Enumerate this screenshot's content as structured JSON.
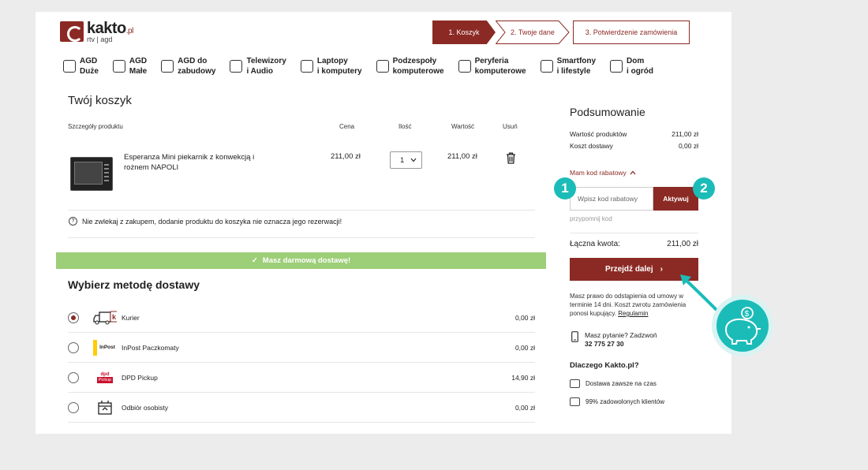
{
  "header": {
    "logo_text": "kakto",
    "logo_tld": ".pl",
    "logo_sub": "rtv | agd",
    "steps": [
      "1. Koszyk",
      "2. Twoje dane",
      "3. Potwierdzenie zamówienia"
    ]
  },
  "categories": [
    {
      "line1": "AGD",
      "line2": "Duże"
    },
    {
      "line1": "AGD",
      "line2": "Małe"
    },
    {
      "line1": "AGD do",
      "line2": "zabudowy"
    },
    {
      "line1": "Telewizory",
      "line2": "i Audio"
    },
    {
      "line1": "Laptopy",
      "line2": "i komputery"
    },
    {
      "line1": "Podzespoły",
      "line2": "komputerowe"
    },
    {
      "line1": "Peryferia",
      "line2": "komputerowe"
    },
    {
      "line1": "Smartfony",
      "line2": "i lifestyle"
    },
    {
      "line1": "Dom",
      "line2": "i ogród"
    }
  ],
  "cart": {
    "title": "Twój koszyk",
    "headers": {
      "details": "Szczegóły produktu",
      "price": "Cena",
      "qty": "Ilość",
      "value": "Wartość",
      "remove": "Usuń"
    },
    "product": {
      "name": "Esperanza Mini piekarnik z konwekcją i rożnem NAPOLI",
      "price": "211,00 zł",
      "qty": "1",
      "value": "211,00 zł"
    },
    "notice": "Nie zwlekaj z zakupem, dodanie produktu do koszyka nie oznacza jego rezerwacji!",
    "free_delivery": "Masz darmową dostawę!"
  },
  "shipping": {
    "title": "Wybierz metodę dostawy",
    "methods": [
      {
        "name": "Kurier",
        "price": "0,00 zł",
        "selected": true
      },
      {
        "name": "InPost Paczkomaty",
        "price": "0,00 zł",
        "selected": false
      },
      {
        "name": "DPD Pickup",
        "price": "14,90 zł",
        "selected": false
      },
      {
        "name": "Odbiór osobisty",
        "price": "0,00 zł",
        "selected": false
      }
    ],
    "icon_labels": {
      "inpost": "InPost",
      "dpd": "dpd",
      "dpd_pickup": "Pickup"
    }
  },
  "summary": {
    "title": "Podsumowanie",
    "products_label": "Wartość produktów",
    "products_value": "211,00 zł",
    "delivery_label": "Koszt dostawy",
    "delivery_value": "0,00 zł",
    "coupon_link": "Mam kod rabatowy",
    "coupon_placeholder": "Wpisz kod rabatowy",
    "coupon_button": "Aktywuj",
    "remind": "przypomnij kod",
    "total_label": "Łączna kwota:",
    "total_value": "211,00 zł",
    "next_button": "Przejdź dalej",
    "legal": "Masz prawo do odstąpienia od umowy w terminie 14 dni. Koszt zwrotu zamówienia ponosi kupujący.",
    "legal_link": "Regulamin",
    "contact_q": "Masz pytanie? Zadzwoń",
    "contact_phone": "32 775 27 30",
    "why_title": "Dlaczego Kakto.pl?",
    "feature1": "Dostawa zawsze na czas",
    "feature2": "99% zadowolonych klientów"
  },
  "annotations": {
    "badge1": "1",
    "badge2": "2",
    "color": "#1bbcb8"
  },
  "colors": {
    "brand": "#8b2a24",
    "success": "#9dce78",
    "accent": "#1bbcb8"
  }
}
